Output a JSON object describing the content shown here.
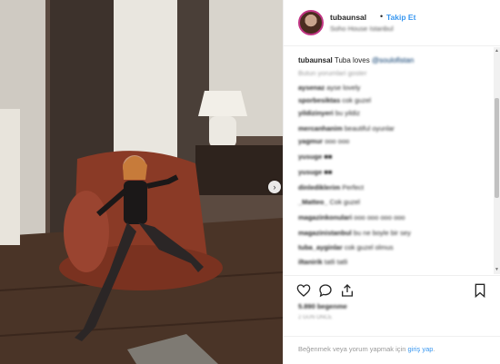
{
  "header": {
    "username": "tubaunsal",
    "separator": "•",
    "follow_label": "Takip Et",
    "location": "Soho House Istanbul"
  },
  "caption": {
    "username": "tubaunsal",
    "text": "Tuba loves",
    "tag": "@soulofistan"
  },
  "more_comments_label": "Butun yorumlari goster",
  "comments": [
    {
      "user": "aysenaz",
      "text": "ayse lovely"
    },
    {
      "user": "sporbesiktas",
      "text": "cok guzel"
    },
    {
      "user": "yildizinyeri",
      "text": "bu yildiz"
    },
    {
      "user": "mercanhanim",
      "text": "beautiful oyunlar"
    },
    {
      "user": "yagmur",
      "text": "ooo ooo"
    },
    {
      "user": "yusuge",
      "text": "■■"
    },
    {
      "user": "yusuge",
      "text": "■■"
    },
    {
      "user": "dinlediklerim",
      "text": "Perfect"
    },
    {
      "user": "_Matteo_",
      "text": "Cok guzel"
    },
    {
      "user": "magazinkonulari",
      "text": "ooo ooo ooo ooo"
    },
    {
      "user": "magazinistanbul",
      "text": "bu ne boyle bir sey"
    },
    {
      "user": "tuba_ayginlar",
      "text": "cok guzel olmus"
    },
    {
      "user": "iltanirik",
      "text": "tatli tatli"
    }
  ],
  "actions": {
    "like_icon": "heart-icon",
    "comment_icon": "comment-icon",
    "share_icon": "share-icon",
    "save_icon": "bookmark-icon"
  },
  "likes_label": "5.890 begenme",
  "time_label": "2 GUN ONCE",
  "login": {
    "prefix": "Beğenmek veya yorum yapmak için",
    "link": "giriş yap",
    "suffix": "."
  }
}
